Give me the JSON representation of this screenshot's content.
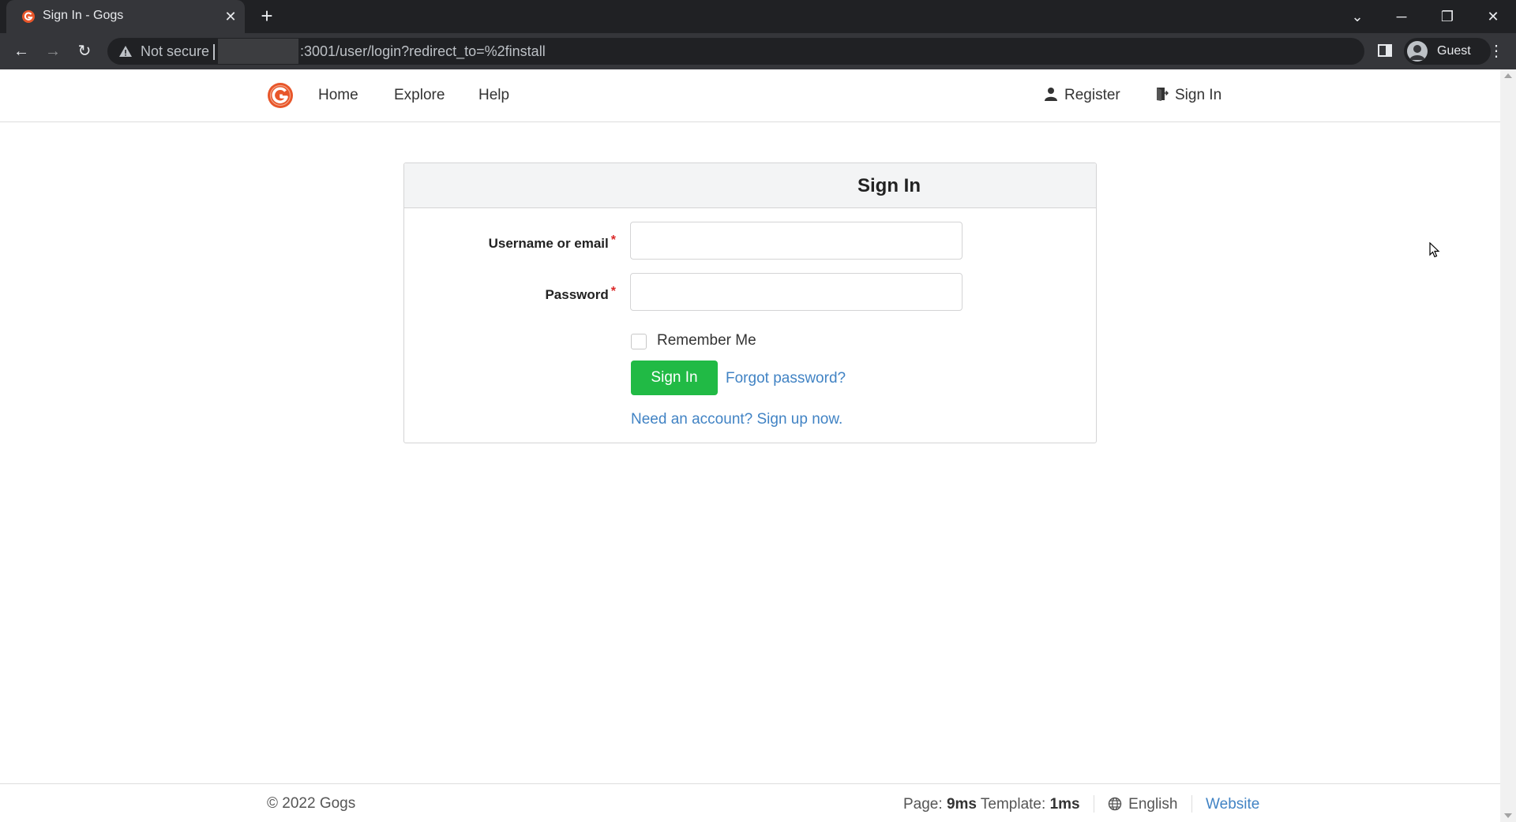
{
  "browser": {
    "tab_title": "Sign In - Gogs",
    "new_tab_symbol": "+",
    "not_secure_label": "Not secure",
    "url_suffix": ":3001/user/login?redirect_to=%2finstall",
    "profile_label": "Guest"
  },
  "header": {
    "nav": {
      "home": "Home",
      "explore": "Explore",
      "help": "Help",
      "register": "Register",
      "sign_in": "Sign In"
    }
  },
  "login": {
    "title": "Sign In",
    "username_label": "Username or email",
    "password_label": "Password",
    "required_marker": "*",
    "username_value": "",
    "password_value": "",
    "remember_label": "Remember Me",
    "remember_checked": false,
    "submit_label": "Sign In",
    "forgot_link": "Forgot password?",
    "signup_link": "Need an account? Sign up now."
  },
  "footer": {
    "copyright": "© 2022 Gogs",
    "page_label": "Page:",
    "page_time": "9ms",
    "template_label": "Template:",
    "template_time": "1ms",
    "language": "English",
    "website_link": "Website"
  },
  "colors": {
    "primary_button": "#21ba45",
    "link": "#4183c4",
    "required": "#db2828",
    "brand": "#e8562a"
  }
}
